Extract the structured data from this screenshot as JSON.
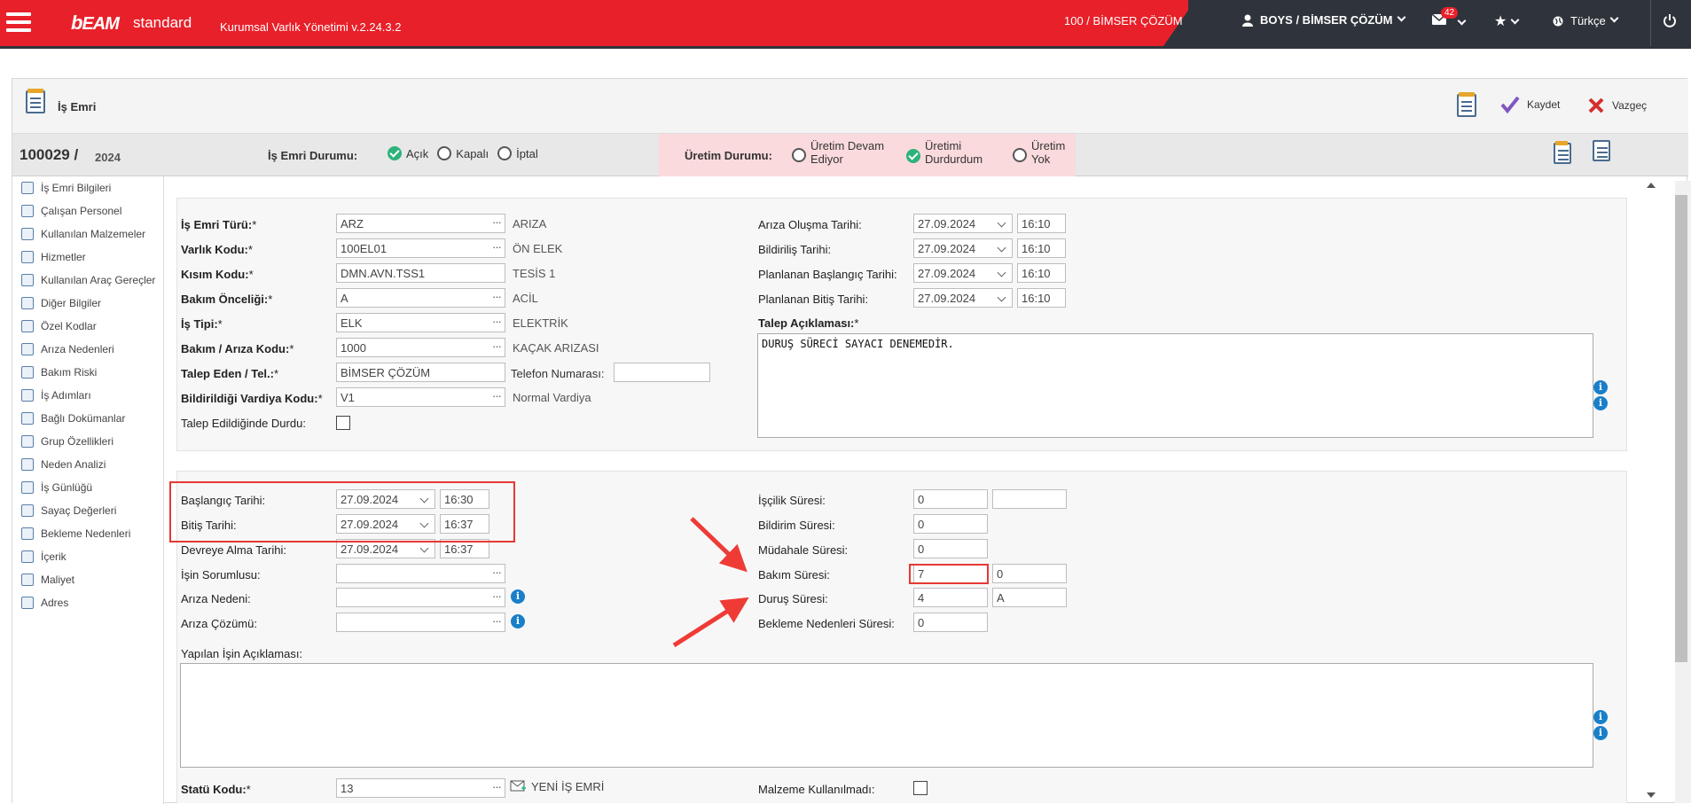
{
  "topbar": {
    "brand": "EAM",
    "brand_suffix": "standard",
    "app_title": "Kurumsal Varlık Yönetimi v.2.24.3.2",
    "company": "100 / BİMSER ÇÖZÜM",
    "user": "BOYS / BİMSER ÇÖZÜM",
    "mail_count": "42",
    "language": "Türkçe",
    "accent": "#e8202a",
    "dark": "#2f343c"
  },
  "header": {
    "title": "İş Emri",
    "save_label": "Kaydet",
    "cancel_label": "Vazgeç"
  },
  "status": {
    "order_no": "100029",
    "separator": "/",
    "year": "2024",
    "wo_status_label": "İş Emri Durumu:",
    "wo_options": [
      "Açık",
      "Kapalı",
      "İptal"
    ],
    "wo_selected": "Açık",
    "prod_status_label": "Üretim Durumu:",
    "prod_opt1_l1": "Üretim Devam",
    "prod_opt1_l2": "Ediyor",
    "prod_opt2_l1": "Üretimi",
    "prod_opt2_l2": "Durdurdum",
    "prod_opt3_l1": "Üretim",
    "prod_opt3_l2": "Yok",
    "prod_selected": "Üretimi Durdurdum"
  },
  "sidebar": {
    "items": [
      "İş Emri Bilgileri",
      "Çalışan Personel",
      "Kullanılan Malzemeler",
      "Hizmetler",
      "Kullanılan Araç Gereçler",
      "Diğer Bilgiler",
      "Özel Kodlar",
      "Arıza Nedenleri",
      "Bakım Riski",
      "İş Adımları",
      "Bağlı Dokümanlar",
      "Grup Özellikleri",
      "Neden Analizi",
      "İş Günlüğü",
      "Sayaç Değerleri",
      "Bekleme Nedenleri",
      "İçerik",
      "Maliyet",
      "Adres"
    ]
  },
  "form1": {
    "is_emri_turu": {
      "label": "İş Emri Türü:",
      "value": "ARZ",
      "desc": "ARIZA"
    },
    "varlik_kodu": {
      "label": "Varlık Kodu:",
      "value": "100EL01",
      "desc": "ÖN ELEK"
    },
    "kisim_kodu": {
      "label": "Kısım Kodu:",
      "value": "DMN.AVN.TSS1",
      "desc": "TESİS 1"
    },
    "bakim_onceligi": {
      "label": "Bakım Önceliği:",
      "value": "A",
      "desc": "ACİL"
    },
    "is_tipi": {
      "label": "İş Tipi:",
      "value": "ELK",
      "desc": "ELEKTRİK"
    },
    "bakim_ariza_kodu": {
      "label": "Bakım / Arıza Kodu:",
      "value": "1000",
      "desc": "KAÇAK ARIZASI"
    },
    "talep_eden": {
      "label": "Talep Eden / Tel.:",
      "value": "BİMSER ÇÖZÜM",
      "tel_label": "Telefon Numarası:",
      "tel_value": ""
    },
    "vardiya": {
      "label": "Bildirildiği Vardiya Kodu:",
      "value": "V1",
      "desc": "Normal Vardiya"
    },
    "talep_durdu": {
      "label": "Talep Edildiğinde Durdu:"
    },
    "ariza_olusma": {
      "label": "Arıza Oluşma Tarihi:",
      "date": "27.09.2024",
      "time": "16:10"
    },
    "bildirilis": {
      "label": "Bildiriliş Tarihi:",
      "date": "27.09.2024",
      "time": "16:10"
    },
    "plan_baslangic": {
      "label": "Planlanan Başlangıç Tarihi:",
      "date": "27.09.2024",
      "time": "16:10"
    },
    "plan_bitis": {
      "label": "Planlanan Bitiş Tarihi:",
      "date": "27.09.2024",
      "time": "16:10"
    },
    "talep_aciklamasi": {
      "label": "Talep Açıklaması:",
      "value": "DURUŞ SÜRECİ SAYACI DENEMEDİR."
    }
  },
  "form2": {
    "baslangic": {
      "label": "Başlangıç Tarihi:",
      "date": "27.09.2024",
      "time": "16:30"
    },
    "bitis": {
      "label": "Bitiş Tarihi:",
      "date": "27.09.2024",
      "time": "16:37"
    },
    "devreye_alma": {
      "label": "Devreye Alma Tarihi:",
      "date": "27.09.2024",
      "time": "16:37"
    },
    "isin_sorumlusu": {
      "label": "İşin Sorumlusu:",
      "value": ""
    },
    "ariza_nedeni": {
      "label": "Arıza Nedeni:",
      "value": ""
    },
    "ariza_cozumu": {
      "label": "Arıza Çözümü:",
      "value": ""
    },
    "iscilik": {
      "label": "İşçilik Süresi:",
      "v1": "0",
      "v2": ""
    },
    "bildirim": {
      "label": "Bildirim Süresi:",
      "v1": "0"
    },
    "mudahale": {
      "label": "Müdahale Süresi:",
      "v1": "0"
    },
    "bakim": {
      "label": "Bakım Süresi:",
      "v1": "7",
      "v2": "0"
    },
    "durus": {
      "label": "Duruş Süresi:",
      "v1": "4",
      "v2": "A"
    },
    "bekleme": {
      "label": "Bekleme Nedenleri Süresi:",
      "v1": "0"
    },
    "yapilan_is": {
      "label": "Yapılan İşin Açıklaması:",
      "value": ""
    },
    "statu_kodu": {
      "label": "Statü Kodu:",
      "value": "13",
      "new_wo": "YENİ İŞ EMRİ"
    },
    "malzeme": {
      "label": "Malzeme Kullanılmadı:"
    }
  },
  "colors": {
    "highlight": "#e53935",
    "ok_green": "#2db37a",
    "info_blue": "#1a7fc9"
  }
}
